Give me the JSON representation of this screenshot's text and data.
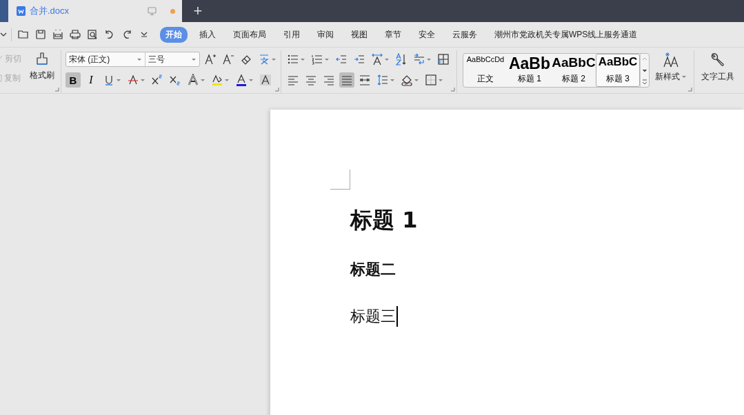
{
  "tab": {
    "title": "合并.docx",
    "unsaved": true
  },
  "new_tab": "+",
  "menu_tabs": [
    {
      "label": "开始",
      "selected": true
    },
    {
      "label": "插入",
      "selected": false
    },
    {
      "label": "页面布局",
      "selected": false
    },
    {
      "label": "引用",
      "selected": false
    },
    {
      "label": "审阅",
      "selected": false
    },
    {
      "label": "视图",
      "selected": false
    },
    {
      "label": "章节",
      "selected": false
    },
    {
      "label": "安全",
      "selected": false
    },
    {
      "label": "云服务",
      "selected": false
    },
    {
      "label": "潮州市党政机关专属WPS线上服务通道",
      "selected": false
    }
  ],
  "clipboard": {
    "cut": "剪切",
    "copy": "复制",
    "format_painter": "格式刷",
    "disabled": true
  },
  "font": {
    "name": "宋体 (正文)",
    "size": "三号",
    "bold_label": "B",
    "bold": true,
    "italic_label": "I",
    "italic": false
  },
  "alignment": [
    {
      "selected": false
    },
    {
      "selected": false
    },
    {
      "selected": false
    },
    {
      "selected": true
    },
    {
      "selected": false
    }
  ],
  "styles": [
    {
      "preview": "AaBbCcDd",
      "label": "正文",
      "kind": "body",
      "selected": false
    },
    {
      "preview": "AaBb",
      "label": "标题 1",
      "kind": "h1",
      "selected": false
    },
    {
      "preview": "AaBbC",
      "label": "标题 2",
      "kind": "h2",
      "selected": false
    },
    {
      "preview": "AaBbC",
      "label": "标题 3",
      "kind": "h3",
      "selected": true
    }
  ],
  "new_style": "新样式",
  "text_tools": "文字工具",
  "document": {
    "paragraphs": [
      {
        "kind": "h1",
        "text": "标题 1",
        "caret": false
      },
      {
        "kind": "h2",
        "text": "标题二",
        "caret": false
      },
      {
        "kind": "h3",
        "text": "标题三",
        "caret": true
      }
    ]
  }
}
